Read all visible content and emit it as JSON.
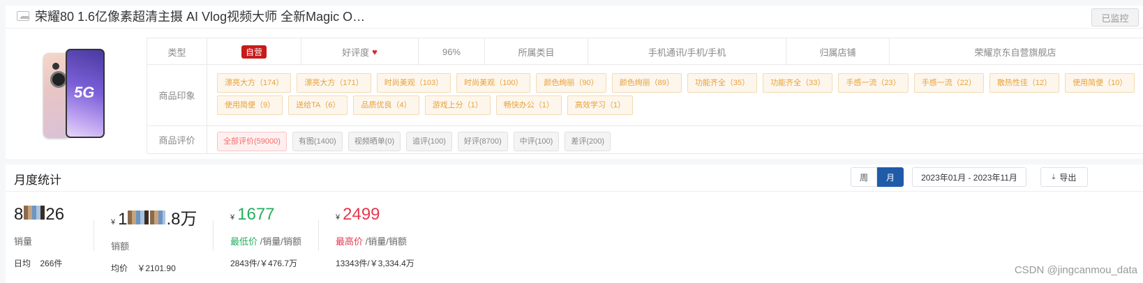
{
  "product": {
    "title": "荣耀80 1.6亿像素超清主摄 AI Vlog视频大师 全新Magic O…",
    "monitor_label": "已监控",
    "image_text": "5G",
    "info": {
      "type_label": "类型",
      "type_value": "自营",
      "rating_label": "好评度",
      "rating_value": "96%",
      "category_label": "所属类目",
      "category_value": "手机通讯/手机/手机",
      "store_label": "归属店铺",
      "store_value": "荣耀京东自营旗舰店"
    },
    "impressions_label": "商品印象",
    "impressions": [
      "漂亮大方（174）",
      "漂亮大方（171）",
      "时尚美观（103）",
      "时尚美观（100）",
      "颜色绚丽（90）",
      "颜色绚丽（89）",
      "功能齐全（35）",
      "功能齐全（33）",
      "手感一流（23）",
      "手感一流（22）",
      "散热性佳（12）",
      "使用简便（10）",
      "使用简便（9）",
      "送给TA（6）",
      "品质优良（4）",
      "游戏上分（1）",
      "畅快办公（1）",
      "高效学习（1）"
    ],
    "reviews_label": "商品评价",
    "reviews": [
      "全部评价(59000)",
      "有图(1400)",
      "视频晒单(0)",
      "追评(100)",
      "好评(8700)",
      "中评(100)",
      "差评(200)"
    ],
    "active_review_index": 0
  },
  "stats": {
    "title": "月度统计",
    "week_label": "周",
    "month_label": "月",
    "date_range": "2023年01月 - 2023年11月",
    "export_label": "导出",
    "sales": {
      "value_prefix": "8",
      "value_suffix": "26",
      "label": "销量",
      "daily_label": "日均",
      "daily_value": "266件"
    },
    "revenue": {
      "currency": "¥",
      "value_prefix": "1",
      "value_mid": "",
      "value_suffix": ".8万",
      "label": "销额",
      "avg_label": "均价",
      "avg_value": "￥2101.90"
    },
    "min_price": {
      "currency": "¥",
      "value": "1677",
      "label": "最低价",
      "label_suffix": " /销量/销额",
      "foot": "2843件/￥476.7万"
    },
    "max_price": {
      "currency": "¥",
      "value": "2499",
      "label": "最高价",
      "label_suffix": " /销量/销额",
      "foot": "13343件/￥3,334.4万"
    }
  },
  "watermark": "CSDN @jingcanmou_data",
  "colors": {
    "accent_blue": "#1f5ba8",
    "self_badge_red": "#c71a1a",
    "tag_orange": "#e6a23c",
    "min_green": "#27ae60",
    "max_red": "#e6394f"
  }
}
